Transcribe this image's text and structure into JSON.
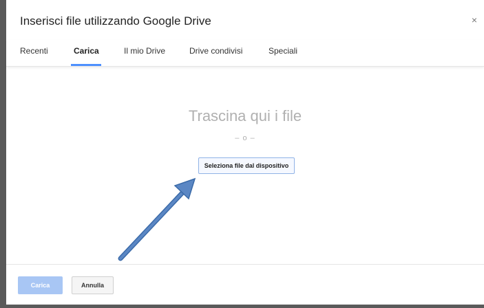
{
  "dialog": {
    "title": "Inserisci file utilizzando Google Drive",
    "close_symbol": "×",
    "tabs": [
      {
        "label": "Recenti"
      },
      {
        "label": "Carica"
      },
      {
        "label": "Il mio Drive"
      },
      {
        "label": "Drive condivisi"
      },
      {
        "label": "Speciali"
      }
    ],
    "active_tab": "Carica",
    "upload": {
      "drop_text": "Trascina qui i file",
      "or_text": "– o –",
      "select_button": "Seleziona file dal dispositivo"
    },
    "footer": {
      "upload_button": "Carica",
      "cancel_button": "Annulla"
    }
  },
  "colors": {
    "accent": "#4d90fe",
    "annotation_arrow": "#5b87c4",
    "disabled_button": "#a8c6f4"
  },
  "icons": {
    "close": "close-icon",
    "annotation": "arrow-icon"
  }
}
